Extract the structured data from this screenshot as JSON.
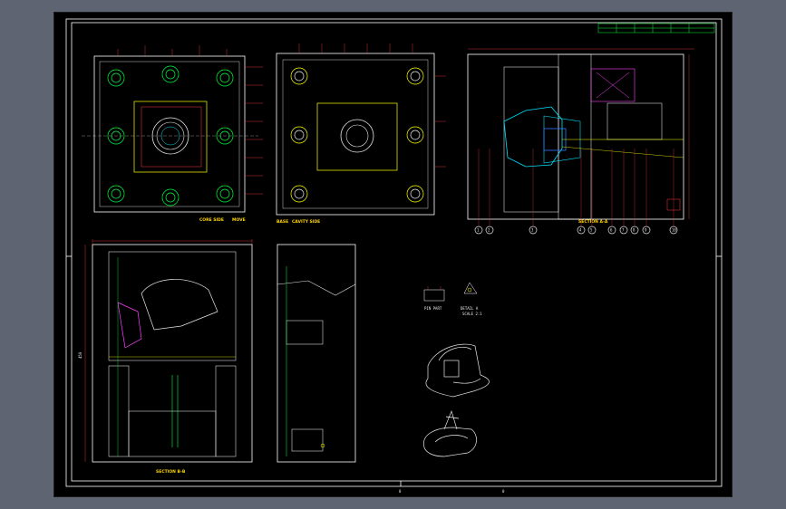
{
  "window": {
    "background_color": "#5e6472",
    "canvas_color": "#000000"
  },
  "colors": {
    "frame": "#ffffff",
    "outline": "#ffffff",
    "dimension": "#ff3b3b",
    "hole": "#00ff3c",
    "cooling": "#ffff00",
    "cavity": "#00e5ff",
    "part": "#e8e8e8",
    "screw": "#2f7bff",
    "accent": "#ff40ff"
  },
  "drawing": {
    "views": {
      "core_side": {
        "title": "CORE SIDE",
        "note": "MOVE"
      },
      "cavity_side": {
        "title": "CAVITY SIDE",
        "note": "BASE"
      },
      "section_aa": {
        "title": "SECTION A-A"
      },
      "section_bb": {
        "title": "SECTION B-B"
      }
    },
    "details": {
      "detail_a": {
        "label": "PIN PART"
      },
      "detail_b": {
        "label": "DETAIL A",
        "sub": "SCALE 2:1"
      }
    },
    "balloons": [
      "1",
      "2",
      "3",
      "4",
      "5",
      "6",
      "7",
      "8",
      "9",
      "10",
      "11",
      "12",
      "13",
      "14"
    ],
    "side_dims": [
      "120",
      "155",
      "60",
      "40",
      "35",
      "45",
      "20",
      "50"
    ],
    "vertical_dim": "450",
    "frame_marks": {
      "bottom_left": "0",
      "bottom_right": "0"
    }
  }
}
